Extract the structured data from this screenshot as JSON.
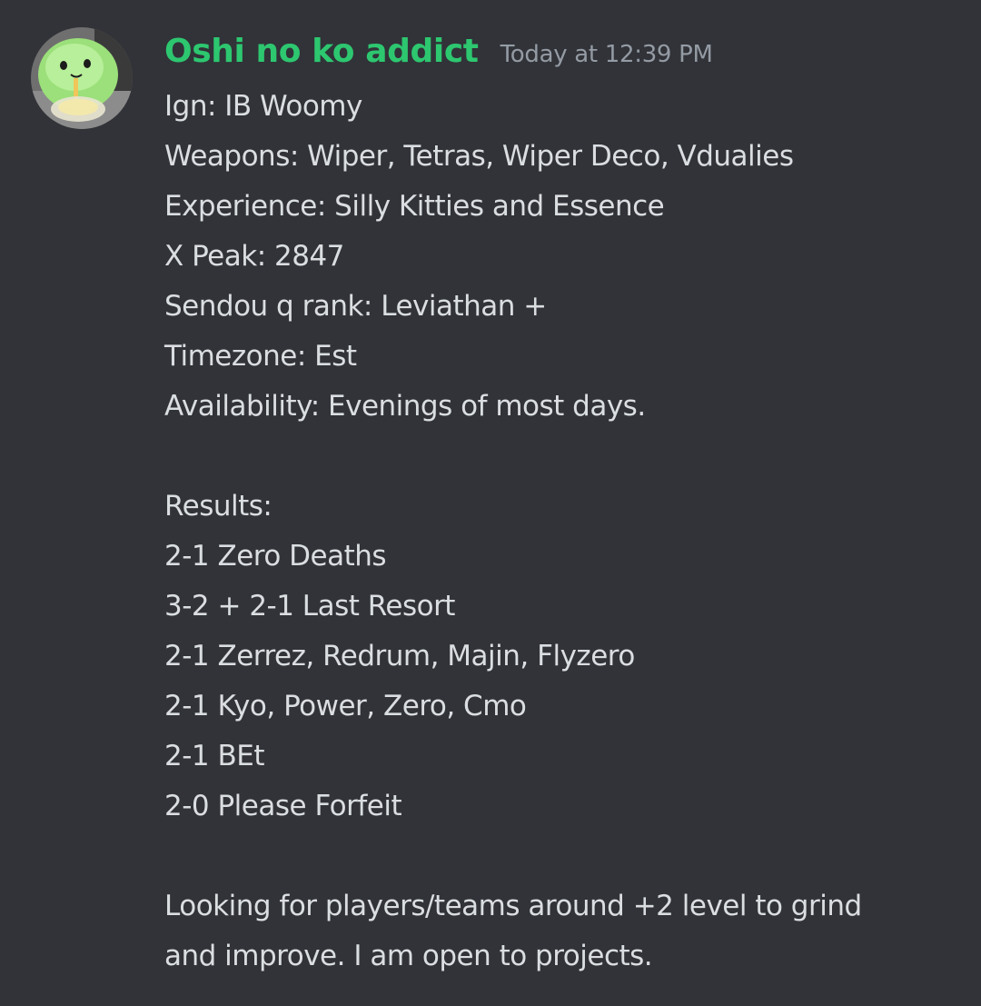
{
  "message": {
    "author": {
      "username": "Oshi no ko addict",
      "username_color": "#2dc770",
      "avatar_icon": "green-plush-avatar-icon"
    },
    "timestamp": "Today at 12:39 PM",
    "lines": [
      "Ign: IB Woomy",
      "Weapons: Wiper, Tetras, Wiper Deco, Vdualies",
      "Experience: Silly Kitties and Essence",
      "X Peak: 2847",
      "Sendou q rank: Leviathan +",
      "Timezone: Est",
      "Availability: Evenings of most days.",
      "",
      "Results:",
      "2-1 Zero Deaths",
      "3-2 + 2-1 Last Resort",
      "2-1 Zerrez, Redrum, Majin, Flyzero",
      "2-1 Kyo, Power, Zero, Cmo",
      "2-1 BEt",
      "2-0 Please Forfeit",
      "",
      "Looking for players/teams around +2 level to grind",
      "and improve. I am open to projects."
    ]
  },
  "colors": {
    "background": "#313338",
    "text": "#dbdee1",
    "timestamp": "#949ba4"
  }
}
